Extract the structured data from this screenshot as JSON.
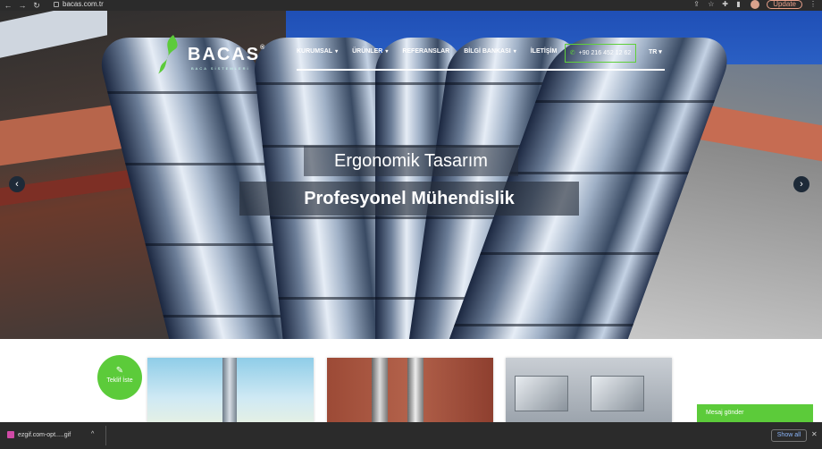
{
  "browser": {
    "url": "bacas.com.tr",
    "update_label": "Update"
  },
  "site": {
    "logo_text": "BACAS",
    "logo_sub": "BACA SİSTEMLERİ",
    "menu": [
      {
        "label": "KURUMSAL",
        "has_dropdown": true
      },
      {
        "label": "ÜRÜNLER",
        "has_dropdown": true
      },
      {
        "label": "REFERANSLAR",
        "has_dropdown": false
      },
      {
        "label": "BİLGİ BANKASI",
        "has_dropdown": true
      },
      {
        "label": "İLETİŞİM",
        "has_dropdown": false
      }
    ],
    "phone": "+90 216 452 12 62",
    "language": "TR",
    "accent_color": "#5ccb3a"
  },
  "hero": {
    "caption_1": "Ergonomik Tasarım",
    "caption_2": "Profesyonel Mühendislik"
  },
  "teklif_button": "Teklif İste",
  "message_button": "Mesaj gönder",
  "download_bar": {
    "file_name": "ezgif.com-opt.....gif",
    "show_all": "Show all"
  }
}
